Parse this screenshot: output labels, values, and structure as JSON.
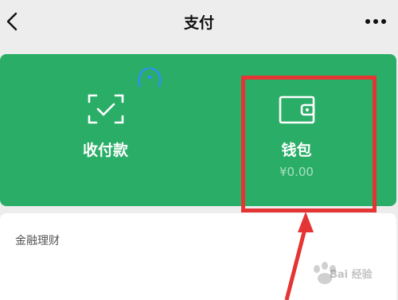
{
  "header": {
    "title": "支付",
    "back_icon": "chevron-left-icon",
    "more_icon": "more-dots-icon"
  },
  "actions": {
    "pay": {
      "label": "收付款",
      "icon": "scan-check-icon"
    },
    "wallet": {
      "label": "钱包",
      "balance": "¥0.00",
      "icon": "wallet-icon"
    }
  },
  "finance": {
    "section_title": "金融理财"
  },
  "colors": {
    "panel_green": "#2aae67",
    "highlight_red": "#e53434",
    "background": "#ededed"
  },
  "watermark": {
    "text": "Bai 经验"
  }
}
